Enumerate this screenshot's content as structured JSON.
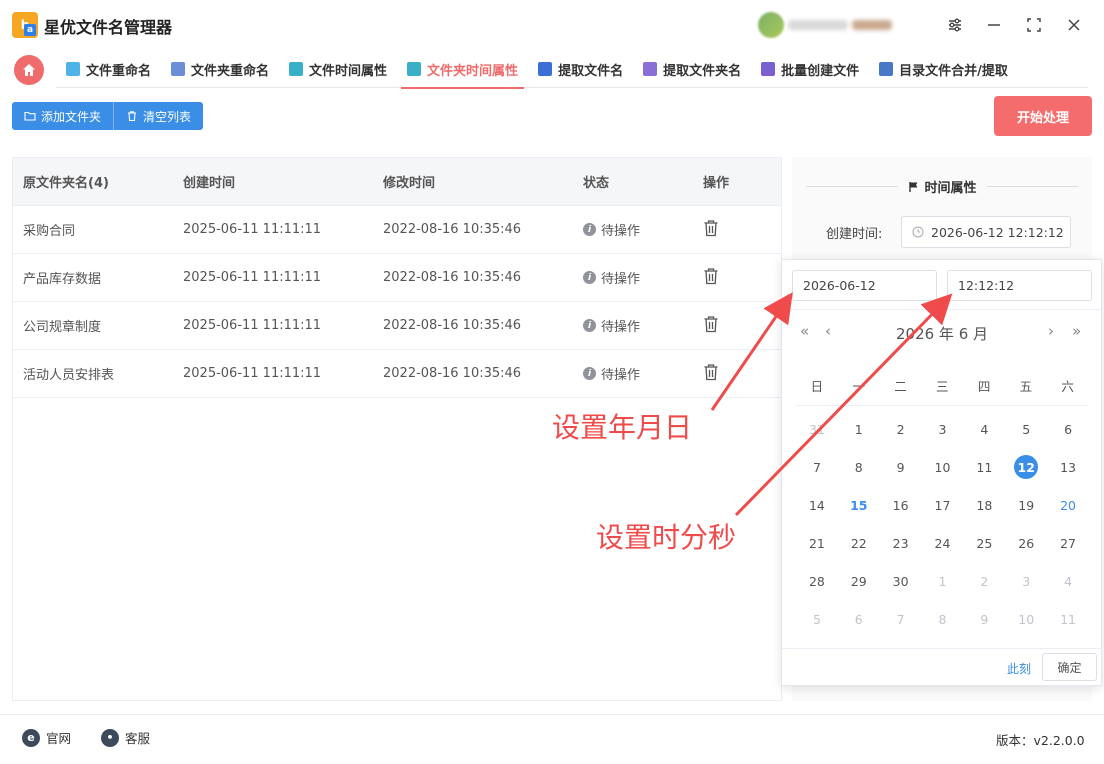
{
  "app": {
    "title": "星优文件名管理器",
    "logo_letters": "b",
    "logo_sub": "a"
  },
  "tabs": [
    {
      "label": "文件重命名",
      "icon_color": "#4fb3e8"
    },
    {
      "label": "文件夹重命名",
      "icon_color": "#6a8fd8"
    },
    {
      "label": "文件时间属性",
      "icon_color": "#3ab0c8"
    },
    {
      "label": "文件夹时间属性",
      "icon_color": "#3ab0c8",
      "active": true
    },
    {
      "label": "提取文件名",
      "icon_color": "#3b6fd6"
    },
    {
      "label": "提取文件夹名",
      "icon_color": "#8a6fd6"
    },
    {
      "label": "批量创建文件",
      "icon_color": "#7a5fd0"
    },
    {
      "label": "目录文件合并/提取",
      "icon_color": "#4a78c8"
    }
  ],
  "toolbar": {
    "add_folder": "添加文件夹",
    "clear_list": "清空列表",
    "start": "开始处理"
  },
  "table": {
    "headers": [
      "原文件夹名(4)",
      "创建时间",
      "修改时间",
      "状态",
      "操作"
    ],
    "rows": [
      {
        "name": "采购合同",
        "created": "2025-06-11 11:11:11",
        "modified": "2022-08-16 10:35:46",
        "status": "待操作"
      },
      {
        "name": "产品库存数据",
        "created": "2025-06-11 11:11:11",
        "modified": "2022-08-16 10:35:46",
        "status": "待操作"
      },
      {
        "name": "公司规章制度",
        "created": "2025-06-11 11:11:11",
        "modified": "2022-08-16 10:35:46",
        "status": "待操作"
      },
      {
        "name": "活动人员安排表",
        "created": "2025-06-11 11:11:11",
        "modified": "2022-08-16 10:35:46",
        "status": "待操作"
      }
    ]
  },
  "panel": {
    "section_title": "时间属性",
    "created_label": "创建时间:",
    "created_value": "2026-06-12 12:12:12"
  },
  "picker": {
    "date_value": "2026-06-12",
    "time_value": "12:12:12",
    "header": "2026 年  6 月",
    "weekdays": [
      "日",
      "一",
      "二",
      "三",
      "四",
      "五",
      "六"
    ],
    "days": [
      [
        "31",
        "muted"
      ],
      [
        "1",
        ""
      ],
      [
        "2",
        ""
      ],
      [
        "3",
        ""
      ],
      [
        "4",
        ""
      ],
      [
        "5",
        ""
      ],
      [
        "6",
        ""
      ],
      [
        "7",
        ""
      ],
      [
        "8",
        ""
      ],
      [
        "9",
        ""
      ],
      [
        "10",
        ""
      ],
      [
        "11",
        ""
      ],
      [
        "12",
        "sel"
      ],
      [
        "13",
        ""
      ],
      [
        "14",
        ""
      ],
      [
        "15",
        "today"
      ],
      [
        "16",
        ""
      ],
      [
        "17",
        ""
      ],
      [
        "18",
        ""
      ],
      [
        "19",
        ""
      ],
      [
        "20",
        "weekend-hl"
      ],
      [
        "21",
        ""
      ],
      [
        "22",
        ""
      ],
      [
        "23",
        ""
      ],
      [
        "24",
        ""
      ],
      [
        "25",
        ""
      ],
      [
        "26",
        ""
      ],
      [
        "27",
        ""
      ],
      [
        "28",
        ""
      ],
      [
        "29",
        ""
      ],
      [
        "30",
        ""
      ],
      [
        "1",
        "muted"
      ],
      [
        "2",
        "muted"
      ],
      [
        "3",
        "muted"
      ],
      [
        "4",
        "muted"
      ],
      [
        "5",
        "muted"
      ],
      [
        "6",
        "muted"
      ],
      [
        "7",
        "muted"
      ],
      [
        "8",
        "muted"
      ],
      [
        "9",
        "muted"
      ],
      [
        "10",
        "muted"
      ],
      [
        "11",
        "muted"
      ]
    ],
    "now": "此刻",
    "confirm": "确定"
  },
  "annotations": {
    "set_date": "设置年月日",
    "set_time": "设置时分秒"
  },
  "footer": {
    "website": "官网",
    "support": "客服",
    "version": "版本：v2.2.0.0"
  },
  "colors": {
    "accent_red": "#f06b6b",
    "primary_blue": "#3a8ee6",
    "annotation_red": "#ef4b4b"
  }
}
